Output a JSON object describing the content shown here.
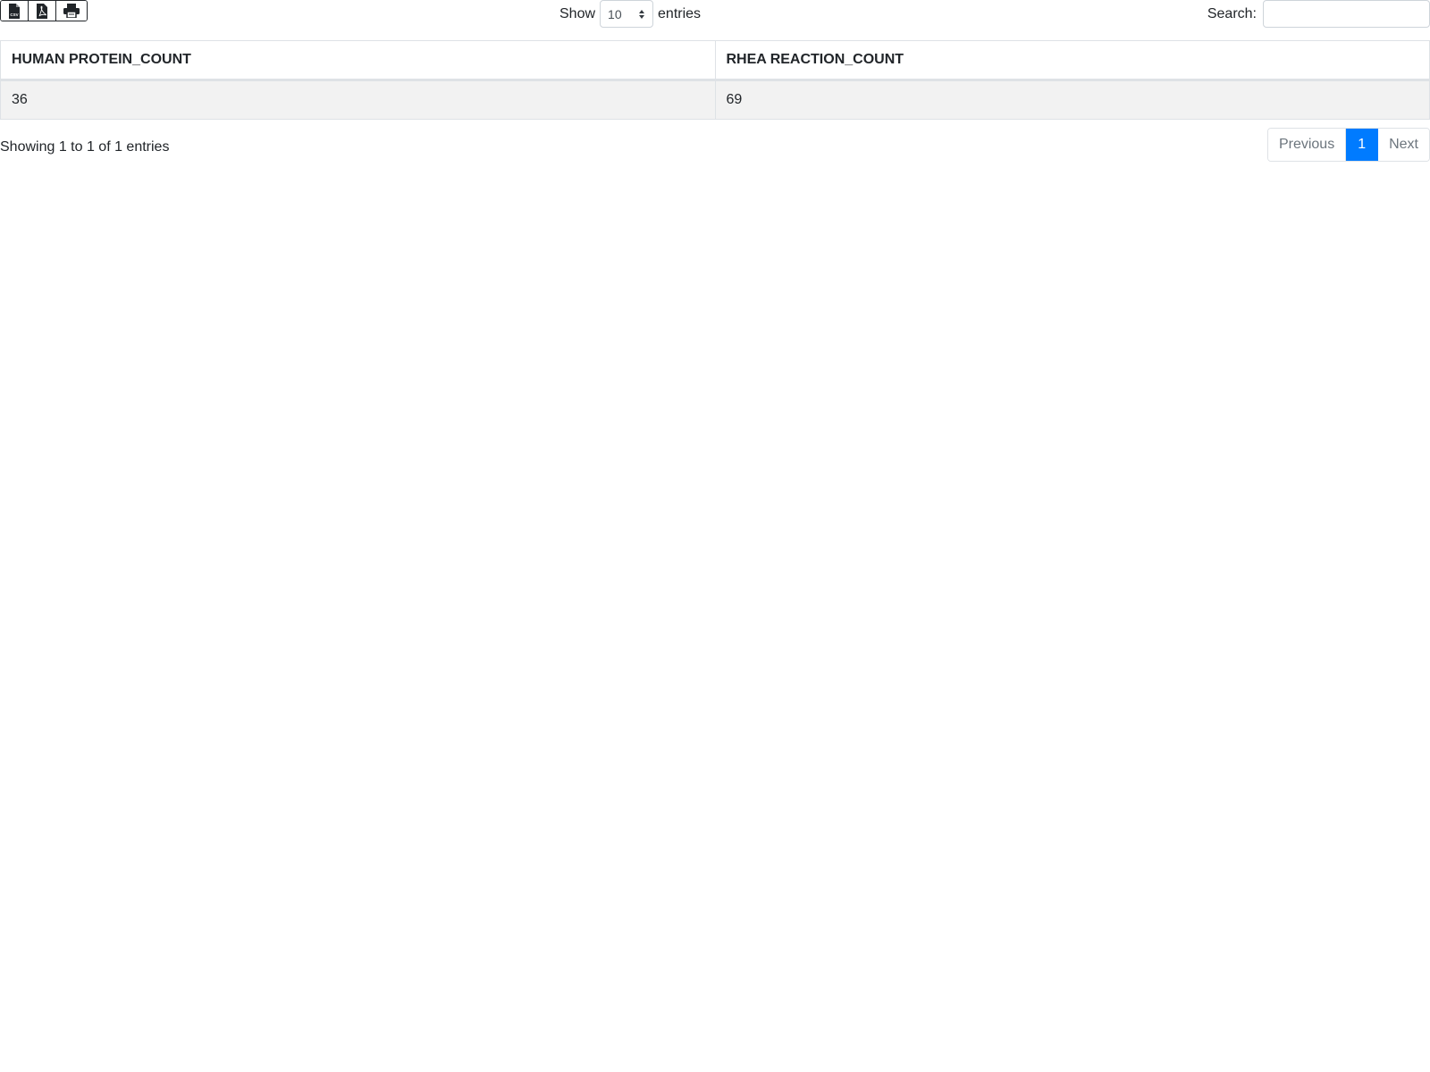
{
  "toolbar": {
    "buttons": [
      {
        "icon": "csv-file-icon"
      },
      {
        "icon": "pdf-file-icon"
      },
      {
        "icon": "print-icon"
      }
    ]
  },
  "length": {
    "prefix": "Show",
    "selected": "10",
    "suffix": "entries"
  },
  "search": {
    "label": "Search:",
    "value": "",
    "placeholder": ""
  },
  "table": {
    "columns": [
      "HUMAN PROTEIN_COUNT",
      "RHEA REACTION_COUNT"
    ],
    "rows": [
      [
        "36",
        "69"
      ]
    ]
  },
  "info": "Showing 1 to 1 of 1 entries",
  "pagination": {
    "previous": "Previous",
    "current": "1",
    "next": "Next"
  },
  "colors": {
    "accent": "#007bff",
    "row_stripe": "#f2f2f2"
  }
}
